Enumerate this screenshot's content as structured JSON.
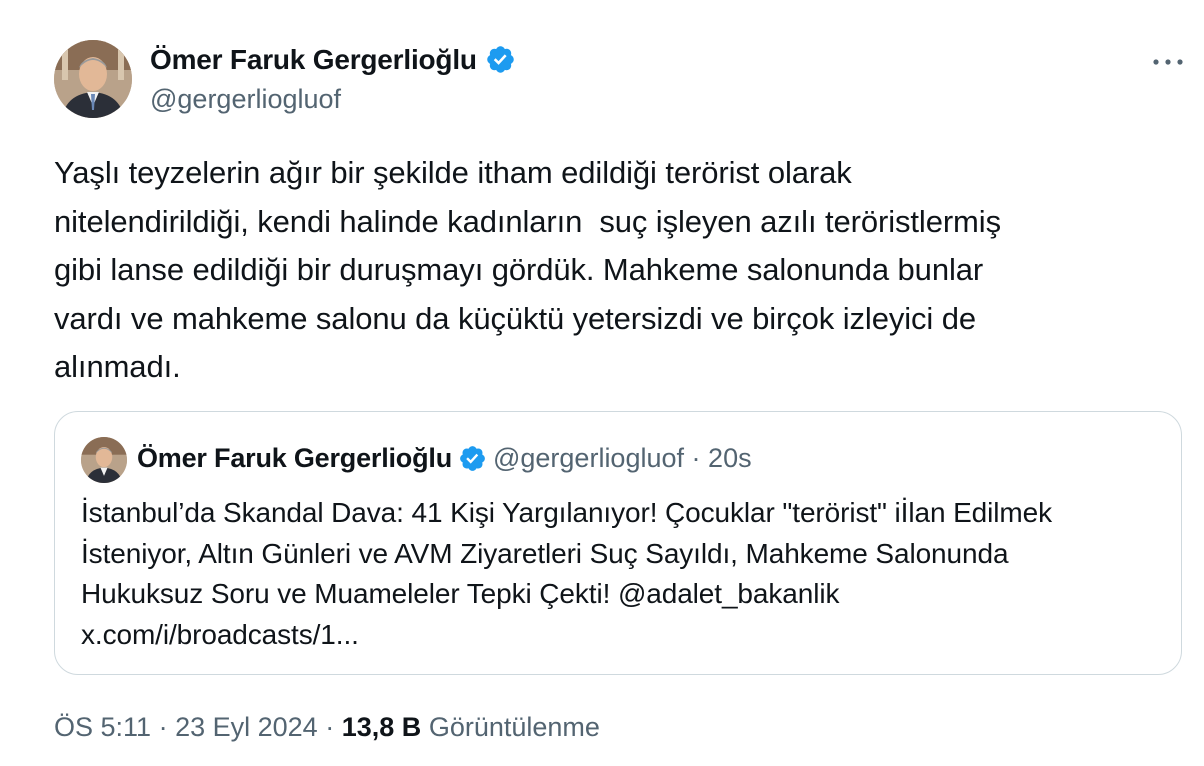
{
  "author": {
    "name": "Ömer Faruk Gergerlioğlu",
    "handle": "@gergerliogluof",
    "verified": true
  },
  "tweet": {
    "text": "Yaşlı teyzelerin ağır bir şekilde itham edildiği terörist olarak\nnitelendirildiği, kendi halinde kadınların  suç işleyen azılı teröristlermiş\ngibi lanse edildiği bir duruşmayı gördük. Mahkeme salonunda bunlar\nvardı ve mahkeme salonu da küçüktü yetersizdi ve birçok izleyici de\nalınmadı."
  },
  "quoted_tweet": {
    "author_name": "Ömer Faruk Gergerlioğlu",
    "handle": "@gergerliogluof",
    "separator": "·",
    "time": "20s",
    "text": "İstanbul’da Skandal Dava: 41 Kişi Yargılanıyor! Çocuklar \"terörist\" iİlan Edilmek\nİsteniyor, Altın Günleri ve AVM Ziyaretleri Suç Sayıldı, Mahkeme Salonunda\nHukuksuz Soru ve Muameleler Tepki Çekti! @adalet_bakanlik\nx.com/i/broadcasts/1..."
  },
  "meta": {
    "time": "ÖS 5:11",
    "dot1": "·",
    "date": "23 Eyl 2024",
    "dot2": "·",
    "views_count": "13,8 B",
    "views_label": "Görüntülenme"
  },
  "icons": {
    "verified": "verified-badge-icon",
    "more": "more-horizontal-icon"
  },
  "colors": {
    "verified_blue": "#1d9bf0",
    "text_primary": "#0f1419",
    "text_secondary": "#536471",
    "border": "#cfd9de"
  }
}
